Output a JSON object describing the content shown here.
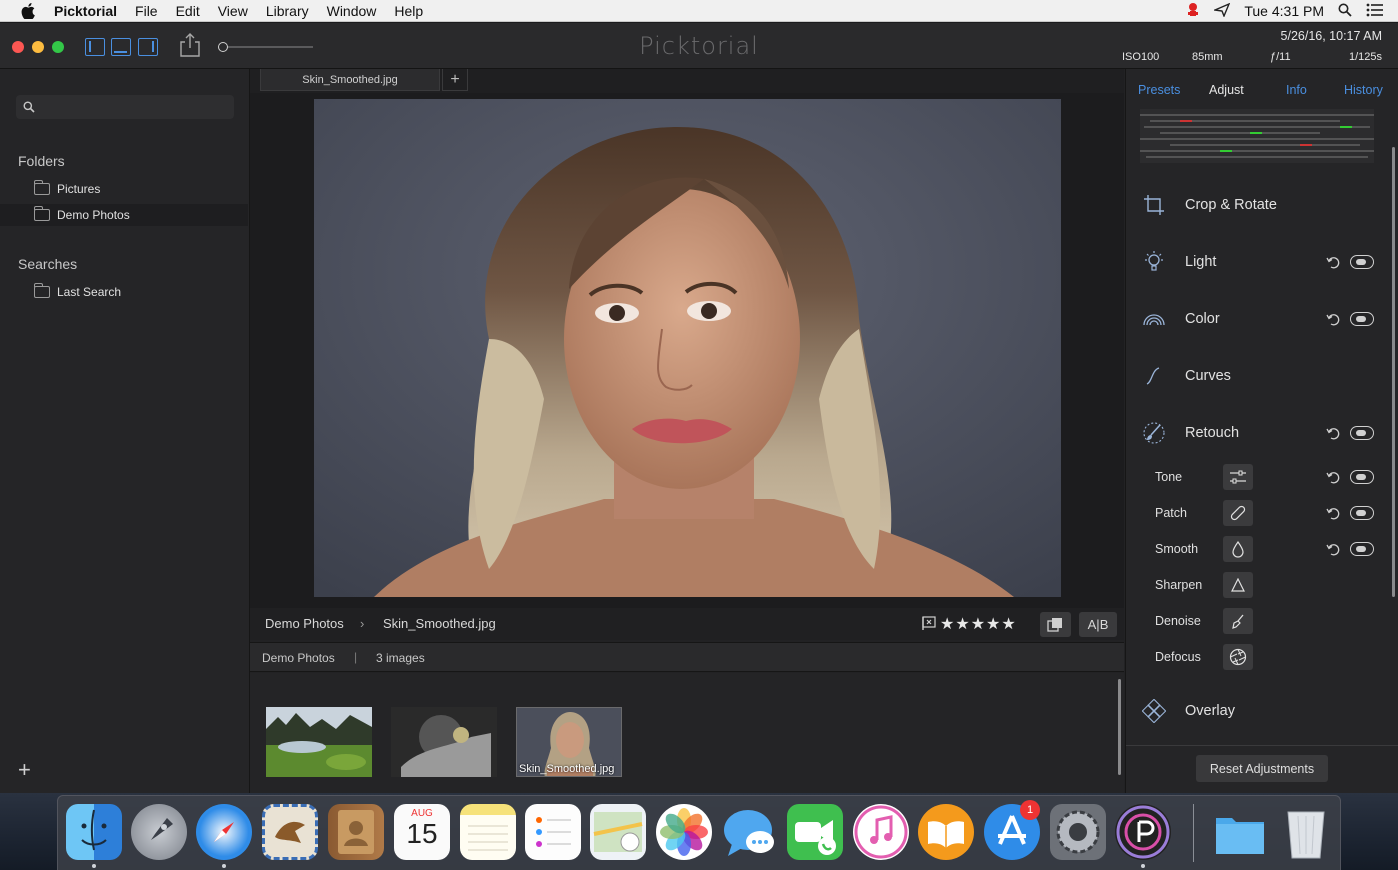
{
  "menubar": {
    "app_name": "Picktorial",
    "menus": [
      "File",
      "Edit",
      "View",
      "Library",
      "Window",
      "Help"
    ],
    "clock": "Tue 4:31 PM"
  },
  "window": {
    "title": "Picktorial",
    "exif": {
      "date": "5/26/16, 10:17 AM",
      "iso": "ISO100",
      "focal": "85mm",
      "aperture": "ƒ/11",
      "shutter": "1/125s"
    }
  },
  "sidebar": {
    "folders_title": "Folders",
    "folders": [
      {
        "label": "Pictures",
        "selected": false
      },
      {
        "label": "Demo Photos",
        "selected": true
      }
    ],
    "searches_title": "Searches",
    "searches": [
      {
        "label": "Last Search"
      }
    ],
    "add_label": "+"
  },
  "tab": {
    "label": "Skin_Smoothed.jpg",
    "add_label": "+"
  },
  "infobar": {
    "folder": "Demo Photos",
    "file": "Skin_Smoothed.jpg",
    "rating": "★★★★★",
    "ab_label": "A|B"
  },
  "filmbar": {
    "folder": "Demo Photos",
    "count": "3 images"
  },
  "film": {
    "thumbs": [
      {
        "name": "landscape",
        "caption": ""
      },
      {
        "name": "bw-hand",
        "caption": ""
      },
      {
        "name": "portrait",
        "caption": "Skin_Smoothed.jpg"
      }
    ]
  },
  "panel": {
    "tabs": [
      "Presets",
      "Adjust",
      "Info",
      "History"
    ],
    "active_tab": "Adjust",
    "tools": [
      {
        "label": "Crop & Rotate",
        "icon": "crop-icon",
        "controls": false
      },
      {
        "label": "Light",
        "icon": "light-bulb-icon",
        "controls": true
      },
      {
        "label": "Color",
        "icon": "color-arc-icon",
        "controls": true
      },
      {
        "label": "Curves",
        "icon": "curve-icon",
        "controls": false
      },
      {
        "label": "Retouch",
        "icon": "brush-icon",
        "controls": true
      }
    ],
    "subtools": [
      {
        "label": "Tone",
        "icon": "sliders-icon",
        "controls": true
      },
      {
        "label": "Patch",
        "icon": "bandage-icon",
        "controls": true
      },
      {
        "label": "Smooth",
        "icon": "drop-icon",
        "controls": true
      },
      {
        "label": "Sharpen",
        "icon": "triangle-icon",
        "controls": false
      },
      {
        "label": "Denoise",
        "icon": "broom-icon",
        "controls": false
      },
      {
        "label": "Defocus",
        "icon": "aperture-icon",
        "controls": false
      }
    ],
    "overlay_label": "Overlay",
    "reset_label": "Reset Adjustments"
  },
  "dock": {
    "calendar_month": "AUG",
    "calendar_day": "15",
    "appstore_badge": "1"
  },
  "colors": {
    "accent": "#4a8fe0",
    "close": "#fc5753",
    "minimize": "#fdbc40",
    "zoom": "#33c748"
  }
}
